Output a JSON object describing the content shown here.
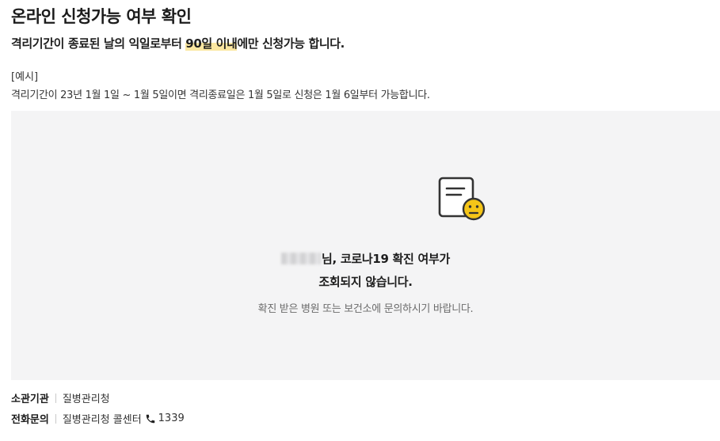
{
  "header": {
    "title": "온라인 신청가능 여부 확인"
  },
  "notice": {
    "before": "격리기간이 종료된 날의 익일로부터 ",
    "highlight": "90일 이내",
    "after": "에만 신청가능 합니다."
  },
  "example": {
    "label": "[예시]",
    "text": "격리기간이 23년 1월 1일 ~ 1월 5일이면 격리종료일은 1월 5일로 신청은 1월 6일부터 가능합니다."
  },
  "result": {
    "icon": "document-neutral-face-icon",
    "name_suffix": "님, 코로나19 확진 여부가",
    "line2": "조회되지 않습니다.",
    "hint": "확진 받은 병원 또는 보건소에 문의하시기 바랍니다."
  },
  "footer": {
    "agency_label": "소관기관",
    "agency_value": "질병관리청",
    "phone_label": "전화문의",
    "phone_value": "질병관리청 콜센터",
    "phone_icon": "phone-icon",
    "phone_number": "1339"
  },
  "colors": {
    "highlight": "#fbe7a1",
    "box_background": "#f4f4f5",
    "face": "#f5c518"
  }
}
